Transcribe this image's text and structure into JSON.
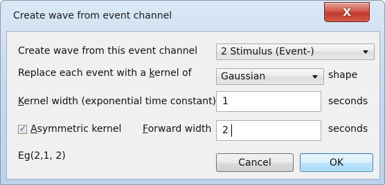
{
  "window": {
    "title": "Create wave from event channel",
    "close_glyph": "X"
  },
  "form": {
    "event_channel_label_pre": "Create wave from this event channel",
    "event_channel_value": "2 Stimulus (Event-)",
    "kernel_label_pre": "Replace each event with a ",
    "kernel_label_key": "k",
    "kernel_label_post": "ernel of",
    "kernel_value": "Gaussian",
    "kernel_suffix": "shape",
    "width_label_key": "K",
    "width_label_post": "ernel width (exponential time constant)",
    "width_value": "1",
    "width_units": "seconds",
    "asym_checked": true,
    "asym_label_key": "A",
    "asym_label_post": "symmetric kernel",
    "forward_label_key": "F",
    "forward_label_post": "orward width",
    "forward_value": "2",
    "forward_units": "seconds",
    "formula": "Eg(2,1, 2)"
  },
  "buttons": {
    "cancel": "Cancel",
    "ok": "OK"
  }
}
